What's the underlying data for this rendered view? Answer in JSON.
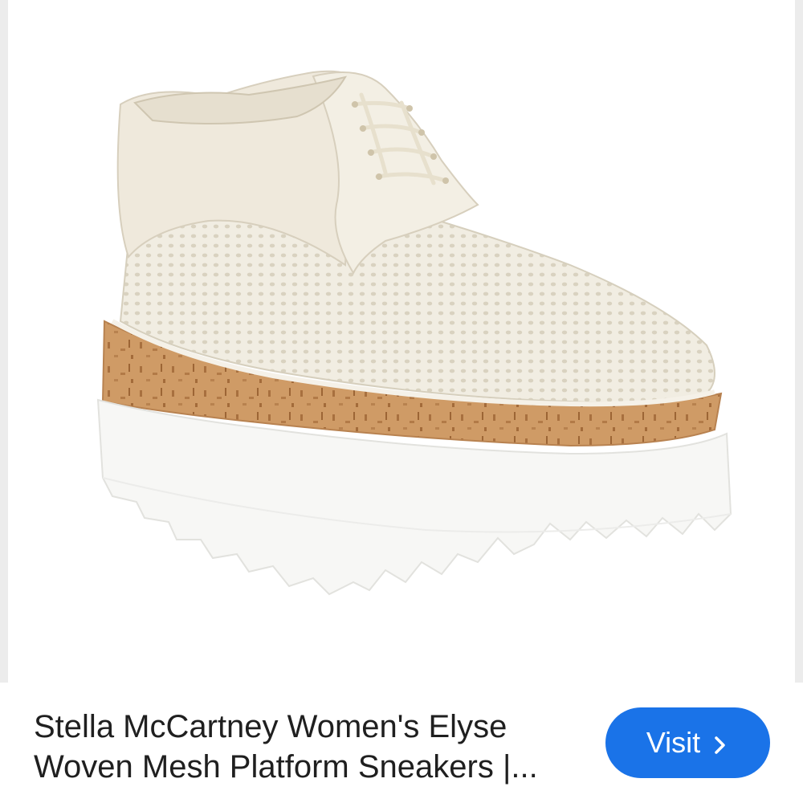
{
  "product": {
    "image_alt": "white mesh platform sneaker with cork midsole",
    "title_line1": "Stella McCartney Women's Elyse",
    "title_line2": "Woven Mesh Platform Sneakers |..."
  },
  "actions": {
    "visit_label": "Visit",
    "visit_icon": "chevron-right-icon"
  },
  "colors": {
    "accent": "#1a73e8",
    "title_text": "#1f1f1f",
    "shoe_upper": "#f1ede2",
    "cork": "#c8935c",
    "sole": "#f7f7f5"
  }
}
